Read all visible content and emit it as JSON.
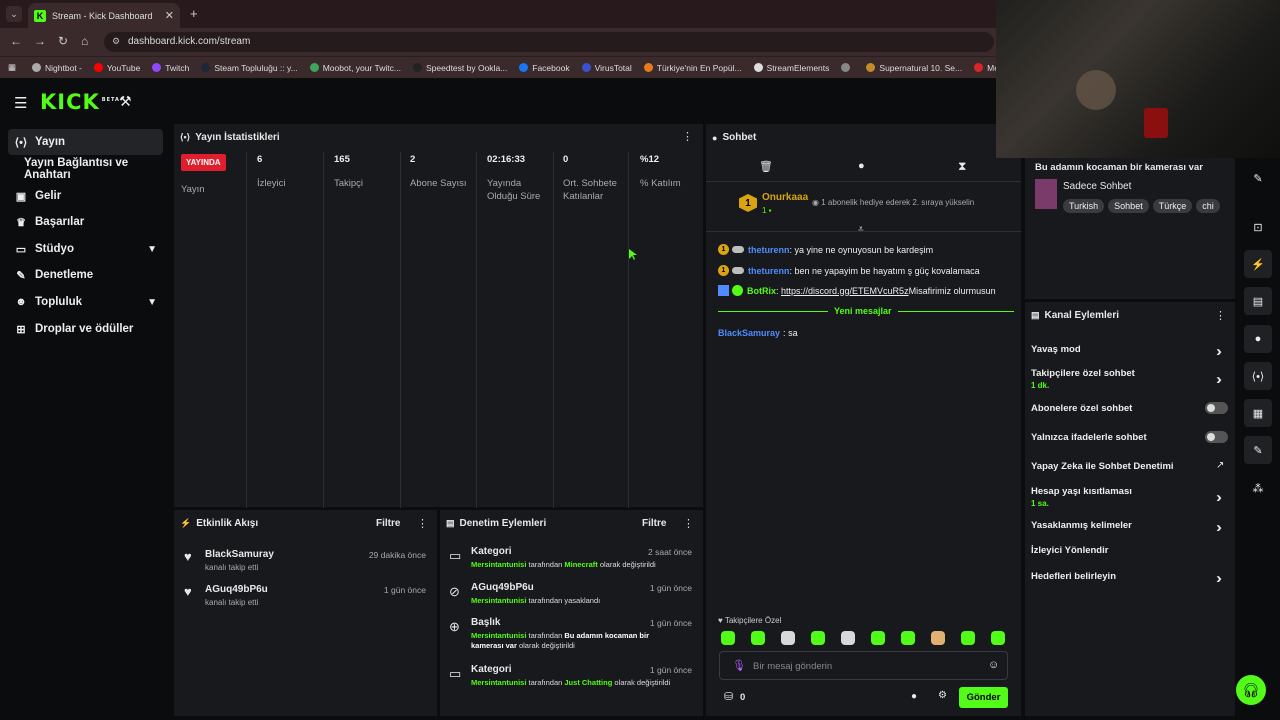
{
  "browser": {
    "tab_title": "Stream - Kick Dashboard",
    "url": "dashboard.kick.com/stream",
    "bookmarks": [
      "Nightbot -",
      "YouTube",
      "Twitch",
      "Steam Topluluğu :: y...",
      "Moobot, your Twitc...",
      "Speedtest by Ookla...",
      "Facebook",
      "VirusTotal",
      "Türkiye'nin En Popül...",
      "StreamElements",
      "",
      "Supernatural 10. Se...",
      "Mersin İsta"
    ]
  },
  "brand": {
    "logo": "KICK",
    "beta": "BETA",
    "accent": "#53fc18"
  },
  "sidebar": {
    "items": [
      {
        "label": "Yayın",
        "icon": "broadcast-icon"
      },
      {
        "label": "Yayın Bağlantısı ve Anahtarı"
      },
      {
        "label": "Gelir",
        "icon": "revenue-icon"
      },
      {
        "label": "Başarılar",
        "icon": "trophy-icon"
      },
      {
        "label": "Stüdyo",
        "icon": "studio-icon"
      },
      {
        "label": "Denetleme",
        "icon": "wrench-icon"
      },
      {
        "label": "Topluluk",
        "icon": "community-icon"
      },
      {
        "label": "Droplar ve ödüller",
        "icon": "gift-icon"
      }
    ]
  },
  "stats": {
    "title": "Yayın İstatistikleri",
    "live_badge": "YAYINDA",
    "live_label": "Yayın",
    "columns": [
      {
        "value": "6",
        "label": "İzleyici"
      },
      {
        "value": "165",
        "label": "Takipçi"
      },
      {
        "value": "2",
        "label": "Abone Sayısı"
      },
      {
        "value": "02:16:33",
        "label": "Yayında Olduğu Süre"
      },
      {
        "value": "0",
        "label": "Ort. Sohbete Katılanlar"
      },
      {
        "value": "%12",
        "label": "% Katılım"
      }
    ]
  },
  "activity": {
    "title": "Etkinlik Akışı",
    "filter": "Filtre",
    "items": [
      {
        "name": "BlackSamuray",
        "sub": "kanalı takip etti",
        "time": "29 dakika önce"
      },
      {
        "name": "AGuq49bP6u",
        "sub": "kanalı takip etti",
        "time": "1 gün önce"
      }
    ]
  },
  "moderation": {
    "title": "Denetim Eylemleri",
    "filter": "Filtre",
    "items": [
      {
        "title": "Kategori",
        "time": "2 saat önce",
        "user": "Mersintantunisi",
        "mid": " tarafından ",
        "value": "Minecraft",
        "end": " olarak değiştirildi"
      },
      {
        "title": "AGuq49bP6u",
        "time": "1 gün önce",
        "user": "Mersintantunisi",
        "mid": " tarafından yasaklandı",
        "value": "",
        "end": ""
      },
      {
        "title": "Başlık",
        "time": "1 gün önce",
        "user": "Mersintantunisi",
        "mid": " tarafından ",
        "value": "Bu adamın kocaman bir kamerası var",
        "end": " olarak değiştirildi"
      },
      {
        "title": "Kategori",
        "time": "1 gün önce",
        "user": "Mersintantunisi",
        "mid": " tarafından ",
        "value": "Just Chatting",
        "end": " olarak değiştirildi"
      }
    ]
  },
  "chat": {
    "title": "Sohbet",
    "pinned_user": "Onurkaaa",
    "pinned_count": "1",
    "pinned_note": "1 abonelik hediye ederek 2. sıraya yükselin",
    "messages": [
      {
        "user": "theturenn",
        "text": "ya yine ne oynuyosun be kardeşim",
        "color": "#4f8cff"
      },
      {
        "user": "theturenn",
        "text": "ben ne yapayim be hayatım ş güç kovalamaca",
        "color": "#4f8cff"
      },
      {
        "user": "BotRix",
        "link": "https://discord.gg/ETEMVcuR5z",
        "text": " Misafirimiz olurmusun",
        "color": "#53fc18"
      }
    ],
    "new_messages": "Yeni mesajlar",
    "after": {
      "user": "BlackSamuray",
      "text": "sa",
      "color": "#4f8cff"
    },
    "followers_only": "Takipçilere Özel",
    "input_placeholder": "Bir mesaj gönderin",
    "points": "0",
    "send": "Gönder"
  },
  "stream_preview": {
    "title": "Bu adamın kocaman bir kamerası var",
    "category": "Sadece Sohbet",
    "tags": [
      "Turkish",
      "Sohbet",
      "Türkçe",
      "chi"
    ]
  },
  "channel_actions": {
    "title": "Kanal Eylemleri",
    "items": [
      {
        "label": "Yavaş mod",
        "sub": "",
        "type": "chevron"
      },
      {
        "label": "Takipçilere özel sohbet",
        "sub": "1 dk.",
        "type": "chevron"
      },
      {
        "label": "Abonelere özel sohbet",
        "sub": "",
        "type": "toggle"
      },
      {
        "label": "Yalnızca ifadelerle sohbet",
        "sub": "",
        "type": "toggle"
      },
      {
        "label": "Yapay Zeka ile Sohbet Denetimi",
        "sub": "",
        "type": "external"
      },
      {
        "label": "Hesap yaşı kısıtlaması",
        "sub": "1 sa.",
        "type": "chevron"
      },
      {
        "label": "Yasaklanmış kelimeler",
        "sub": "",
        "type": "chevron"
      },
      {
        "label": "İzleyici Yönlendir",
        "sub": "",
        "type": "none"
      },
      {
        "label": "Hedefleri belirleyin",
        "sub": "",
        "type": "chevron"
      }
    ]
  }
}
